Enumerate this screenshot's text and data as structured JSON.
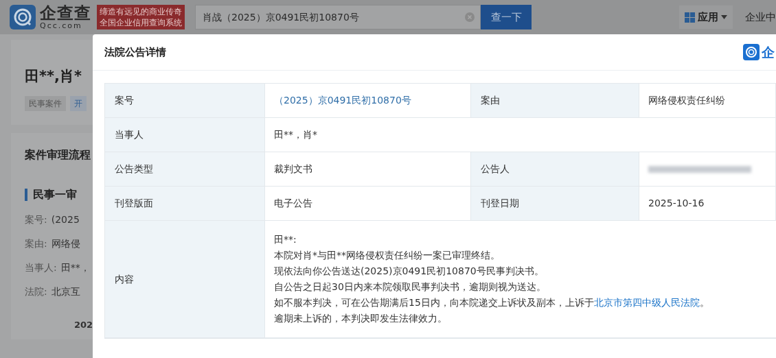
{
  "header": {
    "logo_text": "企查查",
    "logo_domain": "Qcc.com",
    "slogan": [
      "缔造有远见的商业传奇",
      "全国企业信用查询系统"
    ],
    "search": {
      "value": "肖战（2025）京0491民初10870号"
    },
    "search_button": "查一下",
    "apps_menu": "应用",
    "nav_link": "企业中"
  },
  "background_page": {
    "title": "田**,肖*",
    "tags": [
      "民事案件",
      "开"
    ],
    "section_title": "案件审理流程",
    "stage_title": "民事一审",
    "fields": [
      {
        "label": "案号:",
        "value": "(2025"
      },
      {
        "label": "案由:",
        "value": "网络侵"
      },
      {
        "label": "当事人:",
        "value": "田**，"
      },
      {
        "label": "法院:",
        "value": "北京互"
      }
    ],
    "timeline_date": "202"
  },
  "dialog": {
    "title": "法院公告详情",
    "brand_text": "企",
    "rows": [
      {
        "kind": "pair",
        "cells": [
          {
            "label": "案号",
            "value": "（2025）京0491民初10870号",
            "link": true
          },
          {
            "label": "案由",
            "value": "网络侵权责任纠纷",
            "link": false
          }
        ]
      },
      {
        "kind": "single",
        "label": "当事人",
        "value": "田**，肖*"
      },
      {
        "kind": "pair",
        "cells": [
          {
            "label": "公告类型",
            "value": "裁判文书",
            "link": false
          },
          {
            "label": "公告人",
            "redacted": true
          }
        ]
      },
      {
        "kind": "pair",
        "cells": [
          {
            "label": "刊登版面",
            "value": "电子公告",
            "link": false
          },
          {
            "label": "刊登日期",
            "value": "2025-10-16",
            "link": false
          }
        ]
      },
      {
        "kind": "content",
        "label": "内容",
        "lines": [
          {
            "text": "田**:"
          },
          {
            "text": "本院对肖*与田**网络侵权责任纠纷一案已审理终结。"
          },
          {
            "text": "现依法向你公告送达(2025)京0491民初10870号民事判决书。"
          },
          {
            "text": "自公告之日起30日内来本院领取民事判决书，逾期则视为送达。"
          },
          {
            "text": "如不服本判决，可在公告期满后15日内，向本院递交上诉状及副本，上诉于",
            "link_text": "北京市第四中级人民法院",
            "after": "。"
          },
          {
            "text": "逾期未上诉的，本判决即发生法律效力。"
          }
        ]
      }
    ]
  }
}
